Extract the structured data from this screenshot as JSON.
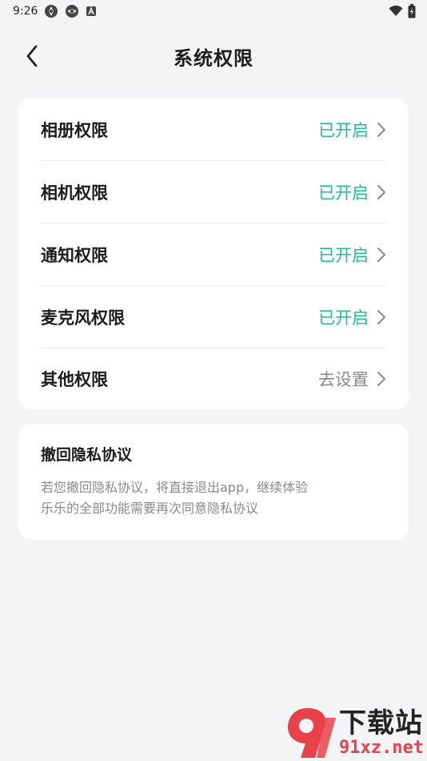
{
  "status_bar": {
    "time": "9:26",
    "icons": [
      "app-icon",
      "app-icon",
      "a-icon"
    ],
    "right_icons": [
      "wifi-icon",
      "battery-icon"
    ]
  },
  "header": {
    "title": "系统权限",
    "back_icon": "chevron-left-icon"
  },
  "permissions": [
    {
      "label": "相册权限",
      "status": "已开启",
      "state": "on"
    },
    {
      "label": "相机权限",
      "status": "已开启",
      "state": "on"
    },
    {
      "label": "通知权限",
      "status": "已开启",
      "state": "on"
    },
    {
      "label": "麦克风权限",
      "status": "已开启",
      "state": "on"
    },
    {
      "label": "其他权限",
      "status": "去设置",
      "state": "off"
    }
  ],
  "revoke": {
    "title": "撤回隐私协议",
    "description": "若您撤回隐私协议，将直接退出app，继续体验乐乐的全部功能需要再次同意隐私协议"
  },
  "watermark": {
    "brand": "下载站",
    "url": "91xz.net"
  },
  "colors": {
    "accent": "#1bbf9a",
    "muted": "#8a8a8e",
    "background": "#f4f4f7",
    "card": "#ffffff",
    "watermark_red": "#e8424a"
  }
}
